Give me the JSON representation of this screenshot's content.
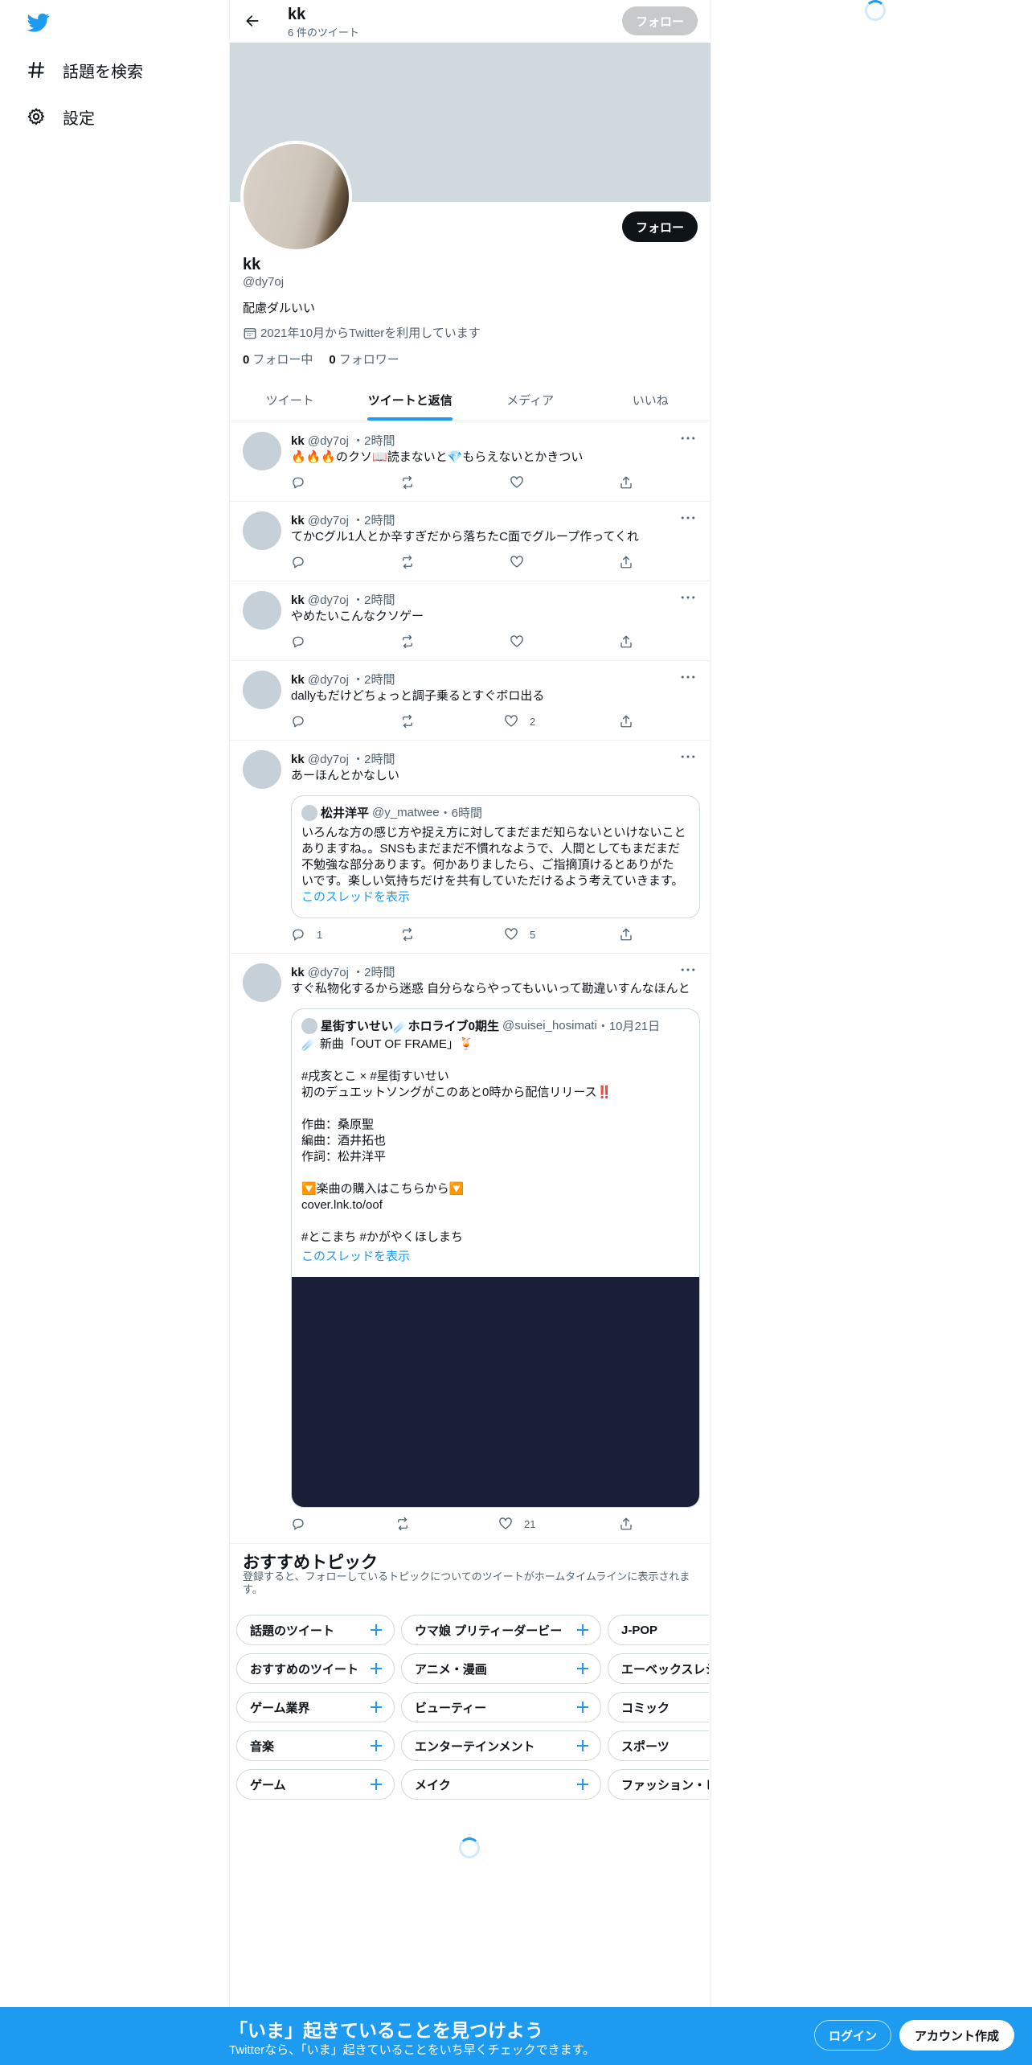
{
  "nav": {
    "logo": "twitter-bird-icon",
    "items": [
      {
        "label": "話題を検索",
        "icon": "hashtag-icon"
      },
      {
        "label": "設定",
        "icon": "gear-icon"
      }
    ]
  },
  "header": {
    "name": "kk",
    "tweet_count": "6 件のツイート",
    "follow_label": "フォロー"
  },
  "profile": {
    "follow_label": "フォロー",
    "name": "kk",
    "handle": "@dy7oj",
    "bio": "配慮ダルいい",
    "joined": "2021年10月からTwitterを利用しています",
    "following_count": "0",
    "following_label": "フォロー中",
    "followers_count": "0",
    "followers_label": "フォロワー"
  },
  "tabs": [
    "ツイート",
    "ツイートと返信",
    "メディア",
    "いいね"
  ],
  "active_tab": "ツイートと返信",
  "tweets": [
    {
      "name": "kk",
      "handle": "@dy7oj",
      "time": "・2時間",
      "text": "🔥🔥🔥のクソ📖読まないと💎もらえないとかきつい",
      "reply": "",
      "retweet": "",
      "like": "",
      "share": ""
    },
    {
      "name": "kk",
      "handle": "@dy7oj",
      "time": "・2時間",
      "text": "てかCグル1人とか辛すぎだから落ちたC面でグループ作ってくれ",
      "reply": "",
      "retweet": "",
      "like": "",
      "share": ""
    },
    {
      "name": "kk",
      "handle": "@dy7oj",
      "time": "・2時間",
      "text": "やめたいこんなクソゲー",
      "reply": "",
      "retweet": "",
      "like": "",
      "share": ""
    },
    {
      "name": "kk",
      "handle": "@dy7oj",
      "time": "・2時間",
      "text": "dallyもだけどちょっと調子乗るとすぐボロ出る",
      "reply": "",
      "retweet": "",
      "like": "2",
      "share": ""
    },
    {
      "name": "kk",
      "handle": "@dy7oj",
      "time": "・2時間",
      "text": "あーほんとかなしい",
      "reply": "1",
      "retweet": "",
      "like": "5",
      "share": "",
      "quote": {
        "name": "松井洋平",
        "handle": "@y_matwee",
        "time": "・6時間",
        "lines": [
          "いろんな方の感じ方や捉え方に対してまだまだ知らないといけないこと",
          "ありますね。。SNSもまだまだ不慣れなようで、人間としてもまだまだ",
          "不勉強な部分あります。何かありましたら、ご指摘頂けるとありがた",
          "いです。楽しい気持ちだけを共有していただけるよう考えていきます。"
        ],
        "link": "このスレッドを表示"
      }
    },
    {
      "name": "kk",
      "handle": "@dy7oj",
      "time": "・2時間",
      "text": "すぐ私物化するから迷惑 自分らならやってもいいって勘違いすんなほんと",
      "reply": "",
      "retweet": "",
      "like": "21",
      "share": "",
      "quote": {
        "name": "星街すいせい☄️ホロライブ0期生",
        "handle": "@suisei_hosimati",
        "time": "・10月21日",
        "lines": [
          "☄️ 新曲「OUT OF FRAME」🍹",
          "",
          "#戌亥とこ × #星街すいせい",
          "初のデュエットソングがこのあと0時から配信リリース‼️",
          "",
          "作曲：桑原聖",
          "編曲：酒井拓也",
          "作詞：松井洋平",
          "",
          "🔽楽曲の購入はこちらから🔽",
          "cover.lnk.to/oof",
          "",
          "#とこまち #かがやくほしまち"
        ],
        "link": "このスレッドを表示"
      }
    }
  ],
  "topics": {
    "title": "おすすめトピック",
    "subtitle": "登録すると、フォローしているトピックについてのツイートがホームタイムラインに表示されます。",
    "rows": [
      [
        "話題のツイート",
        "ウマ娘 プリティーダービー",
        "J-POP"
      ],
      [
        "おすすめのツイート",
        "アニメ・漫画",
        "エーベックスレシ"
      ],
      [
        "ゲーム業界",
        "ビューティー",
        "コミック"
      ],
      [
        "音楽",
        "エンターテインメント",
        "スポーツ"
      ],
      [
        "ゲーム",
        "メイク",
        "ファッション・ビ"
      ]
    ]
  },
  "bottom_bar": {
    "title": "「いま」起きていることを見つけよう",
    "subtitle": "Twitterなら、「いま」起きていることをいち早くチェックできます。",
    "login": "ログイン",
    "signup": "アカウント作成"
  },
  "colors": {
    "accent": "#1d9bf0",
    "banner": "#cfd9de",
    "text": "#0f1419",
    "secondary": "#536471"
  }
}
